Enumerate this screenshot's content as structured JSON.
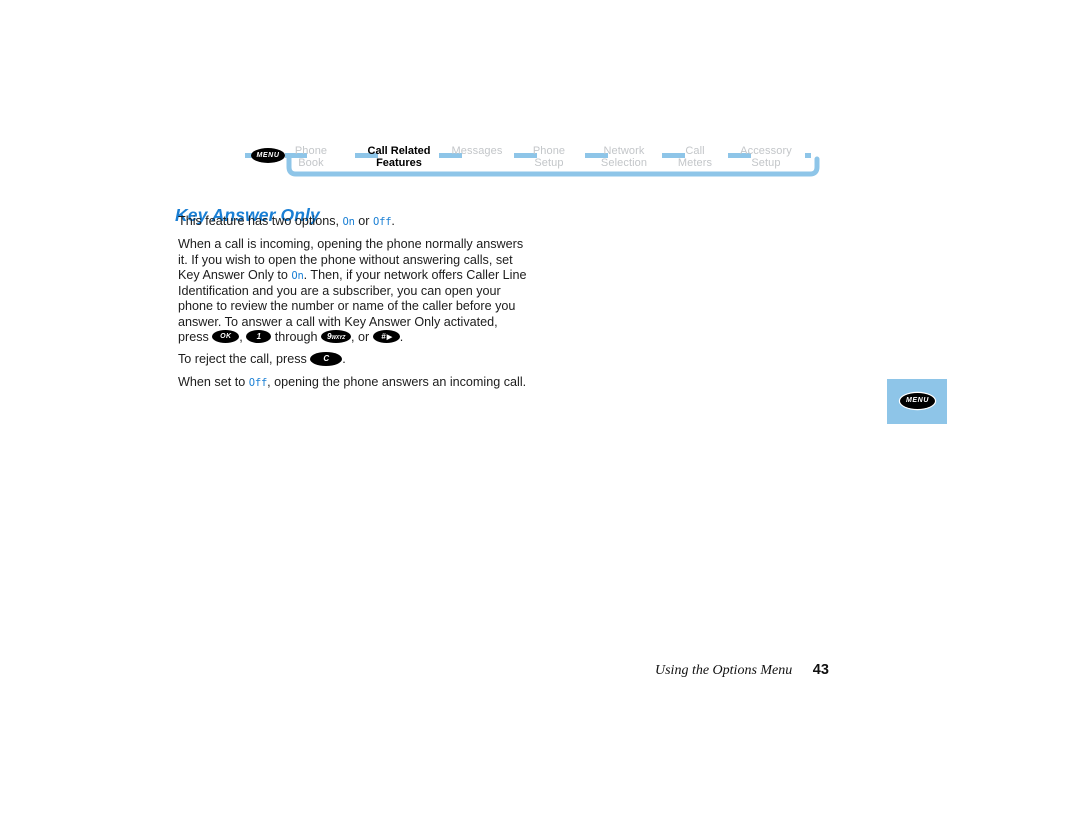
{
  "breadcrumb": {
    "start_icon_label": "MENU",
    "items": [
      {
        "line1": "Phone",
        "line2": "Book",
        "active": false
      },
      {
        "line1": "Call Related",
        "line2": "Features",
        "active": true
      },
      {
        "line1": "Messages",
        "line2": "",
        "active": false
      },
      {
        "line1": "Phone",
        "line2": "Setup",
        "active": false
      },
      {
        "line1": "Network",
        "line2": "Selection",
        "active": false
      },
      {
        "line1": "Call",
        "line2": "Meters",
        "active": false
      },
      {
        "line1": "Accessory",
        "line2": "Setup",
        "active": false
      }
    ],
    "path_color": "#8ec5e8",
    "inactive_color": "#c3c6c9",
    "active_color": "#000000"
  },
  "page": {
    "title": "Key Answer Only",
    "title_color": "#1a7fd4",
    "paragraphs": {
      "p1_a": "This feature has two options, ",
      "p1_on": "On",
      "p1_b": " or ",
      "p1_off": "Off",
      "p1_c": ".",
      "p2_a": "When a call is incoming, opening the phone normally answers it. If you wish to open the phone without answering calls, set Key Answer Only to ",
      "p2_on": "On",
      "p2_b": ". Then, if your network offers Caller Line Identification and you are a subscriber, you can open your phone to review the number or name of the caller before you answer. To answer a call with Key Answer Only activated, press ",
      "p2_c": ", ",
      "p2_d": " through ",
      "p2_e": ", or ",
      "p2_f": ".",
      "p3_a": "To reject the call, press ",
      "p3_b": ".",
      "p4_a": "When set to ",
      "p4_off": "Off",
      "p4_b": ", opening the phone answers an incoming call."
    },
    "keys": {
      "ok": "OK",
      "one": "1",
      "nine_digit": "9",
      "nine_letters": "WXYZ",
      "hash": "#",
      "hash_arrow": "▶",
      "clear": "C"
    }
  },
  "margin_chip": {
    "label": "MENU",
    "background": "#8ec5e8"
  },
  "footer": {
    "text": "Using the Options Menu",
    "page_number": "43"
  }
}
